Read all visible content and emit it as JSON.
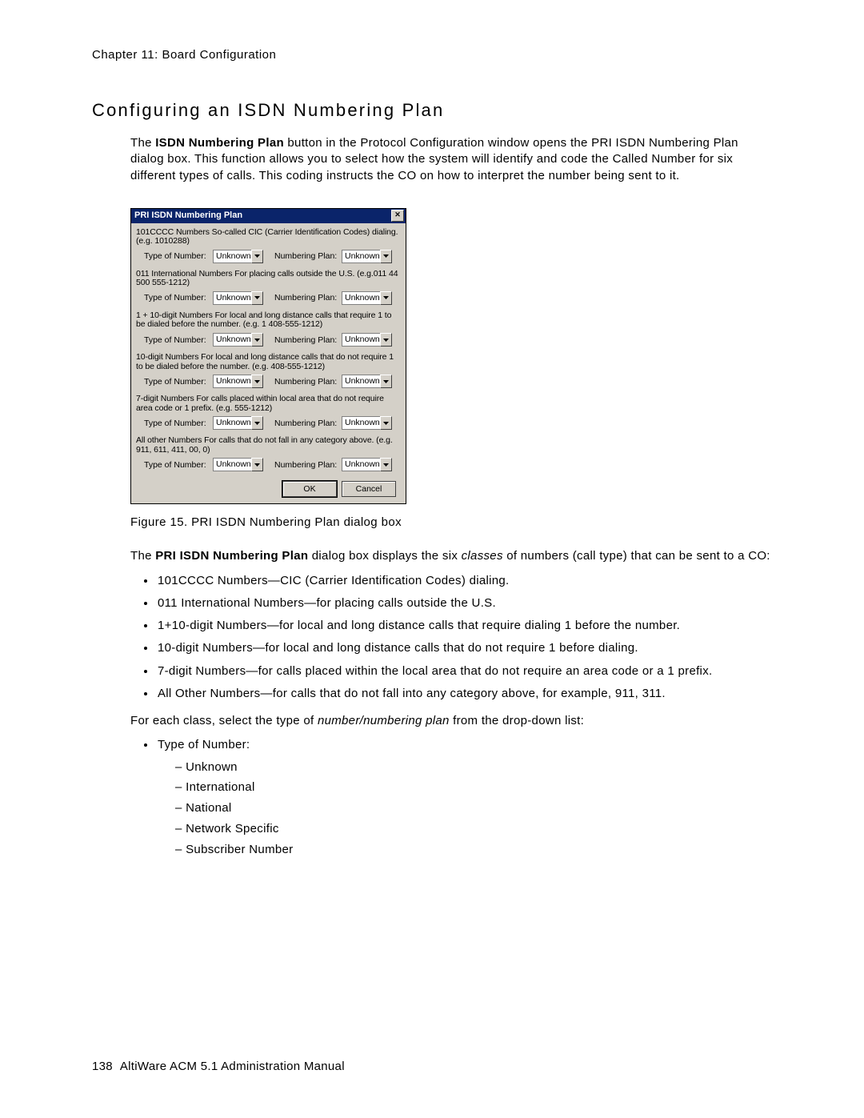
{
  "header": {
    "chapter_label": "Chapter 11:  Board Configuration"
  },
  "section": {
    "title": "Configuring an ISDN Numbering Plan"
  },
  "intro": {
    "pre": "The ",
    "bold": "ISDN Numbering Plan",
    "post": " button in the Protocol Configuration window opens the PRI ISDN Numbering Plan dialog box. This function allows you to select how the system will identify and code the Called Number for six different types of calls. This coding instructs the CO on how to interpret the number being sent to it."
  },
  "dialog": {
    "title": "PRI ISDN Numbering Plan",
    "close": "✕",
    "type_label": "Type of Number:",
    "plan_label": "Numbering Plan:",
    "value": "Unknown",
    "ok": "OK",
    "cancel": "Cancel",
    "sections": [
      "101CCCC Numbers So-called CIC (Carrier Identification Codes) dialing. (e.g. 1010288)",
      "011 International Numbers For placing calls outside the U.S. (e.g.011 44 500 555-1212)",
      "1 + 10-digit Numbers For local and long distance calls that require 1 to be dialed before the number. (e.g. 1 408-555-1212)",
      "10-digit Numbers For local and long distance calls that do not require 1 to be dialed before the number. (e.g. 408-555-1212)",
      "7-digit Numbers For calls placed within local area that do not require area code or 1 prefix. (e.g. 555-1212)",
      "All other Numbers For calls that do not fall in any category above. (e.g. 911, 611, 411, 00, 0)"
    ]
  },
  "figure_caption": "Figure 15.   PRI ISDN Numbering Plan dialog box",
  "para2": {
    "pre": "The ",
    "bold": "PRI ISDN Numbering Plan",
    "mid": " dialog box displays the six ",
    "italic": "classes",
    "post": " of numbers (call type) that can be sent to a CO:"
  },
  "bullets": [
    "101CCCC Numbers—CIC (Carrier Identification Codes) dialing.",
    "011 International Numbers—for placing calls outside the U.S.",
    "1+10-digit Numbers—for local and long distance calls that require dialing 1 before the number.",
    "10-digit Numbers—for local and long distance calls that do not require 1 before dialing.",
    "7-digit Numbers—for calls placed within the local area that do not require an area code or a 1 prefix.",
    "All Other Numbers—for calls that do not fall into any category above, for example, 911, 311."
  ],
  "para3": {
    "pre": "For each class, select the type of ",
    "italic": "number/numbering plan",
    "post": " from the drop-down list:"
  },
  "sublist_header": "Type of Number:",
  "sublist": [
    "Unknown",
    "International",
    "National",
    "Network Specific",
    "Subscriber Number"
  ],
  "footer": {
    "page": "138",
    "title": "AltiWare ACM 5.1 Administration Manual"
  }
}
